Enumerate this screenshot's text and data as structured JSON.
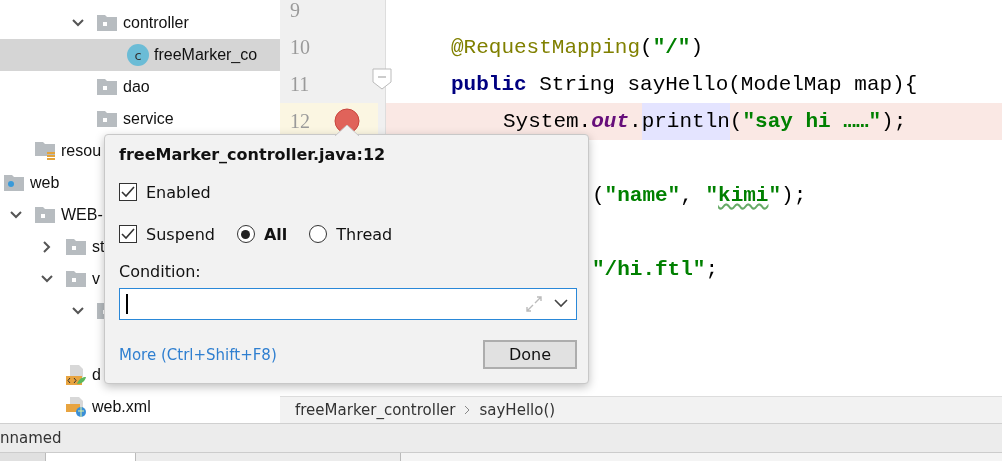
{
  "project_tree": [
    {
      "children": [
        {
          "children": [
            {
              "children": [
                {
                  "label": "controller",
                  "kind": "folder",
                  "expanded": true,
                  "selected": false,
                  "children": [
                    {
                      "label": "freeMarker_co",
                      "kind": "class",
                      "badge": "c",
                      "selected": true
                    }
                  ]
                },
                {
                  "label": "dao",
                  "kind": "folder",
                  "selected": false
                },
                {
                  "label": "service",
                  "kind": "folder",
                  "selected": false
                }
              ]
            }
          ]
        },
        {
          "label": "resou",
          "kind": "resources",
          "selected": false
        }
      ]
    },
    {
      "label": "web",
      "kind": "web",
      "selected": false,
      "children": [
        {
          "label": "WEB-",
          "kind": "folder",
          "expanded": true,
          "selected": false,
          "children": [
            {
              "label": "st",
              "kind": "folder",
              "expanded": false,
              "selected": false
            },
            {
              "label": "v",
              "kind": "folder",
              "expanded": true,
              "selected": false,
              "children": [
                {
                  "kind": "folder",
                  "expanded": true,
                  "selected": false
                }
              ]
            },
            {
              "label": "d",
              "kind": "xml",
              "selected": false
            },
            {
              "label": "web.xml",
              "kind": "xml-web",
              "selected": false
            }
          ]
        }
      ]
    }
  ],
  "editor": {
    "lines": [
      {
        "number": "9",
        "kind": "blank",
        "breakpoint": false,
        "fold": false
      },
      {
        "number": "10",
        "kind": "member",
        "breakpoint": false,
        "fold": false,
        "segments": [
          {
            "kind": "annotation",
            "text": "@RequestMapping"
          },
          {
            "kind": "plain",
            "text": "("
          },
          {
            "kind": "string",
            "text": "\"/\""
          },
          {
            "kind": "plain",
            "text": ")"
          }
        ]
      },
      {
        "number": "11",
        "kind": "member",
        "breakpoint": false,
        "fold": true,
        "segments": [
          {
            "kind": "keyword",
            "text": "public"
          },
          {
            "kind": "plain",
            "text": " String sayHello(ModelMap map){"
          }
        ]
      },
      {
        "number": "12",
        "kind": "statement",
        "breakpoint": true,
        "fold": false,
        "segments": [
          {
            "kind": "plain",
            "text": "System."
          },
          {
            "kind": "static",
            "text": "out"
          },
          {
            "kind": "plain",
            "text": "."
          },
          {
            "kind": "match",
            "text": "println"
          },
          {
            "kind": "plain",
            "text": "("
          },
          {
            "kind": "string",
            "text": "\"say hi ……\""
          },
          {
            "kind": "plain",
            "text": ");"
          }
        ]
      },
      {
        "kind": "blank"
      },
      {
        "kind": "partial",
        "segments": [
          {
            "kind": "plain",
            "text": "("
          },
          {
            "kind": "string",
            "text": "\"name\""
          },
          {
            "kind": "plain",
            "text": ", "
          },
          {
            "kind": "string",
            "text": "\""
          },
          {
            "kind": "typo",
            "text": "kimi"
          },
          {
            "kind": "string",
            "text": "\""
          },
          {
            "kind": "plain",
            "text": ");"
          }
        ]
      },
      {
        "kind": "blank"
      },
      {
        "kind": "partial",
        "segments": [
          {
            "kind": "string",
            "text": "\"/hi.ftl\""
          },
          {
            "kind": "plain",
            "text": ";"
          }
        ]
      }
    ]
  },
  "breadcrumb": [
    "freeMarker_controller",
    "sayHello()"
  ],
  "status_bar": {
    "text": "nnamed"
  },
  "breakpoint_popup": {
    "title": "freeMarker_controller.java:12",
    "enabled": {
      "label": "Enabled",
      "checked": true
    },
    "suspend": {
      "label": "Suspend",
      "checked": true
    },
    "suspend_options": [
      {
        "label": "All",
        "selected": true
      },
      {
        "label": "Thread",
        "selected": false
      }
    ],
    "condition": {
      "label": "Condition:"
    },
    "more_link": "More (Ctrl+Shift+F8)",
    "done_button": "Done"
  }
}
